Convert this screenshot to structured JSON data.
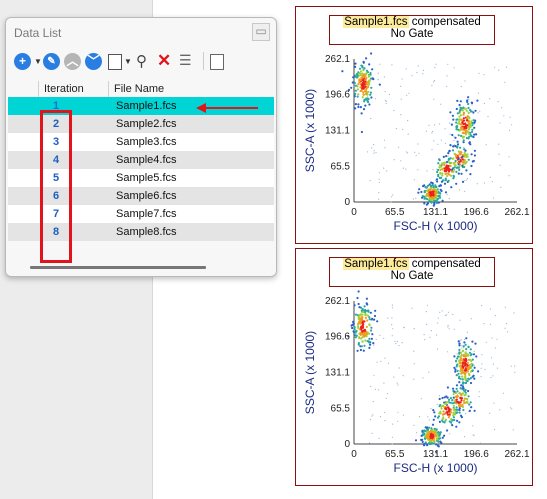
{
  "panel": {
    "title": "Data List",
    "close_glyph": "▭",
    "toolbar_icons": [
      "add-icon",
      "wrench-icon",
      "up-arrow-icon",
      "down-arrow-icon",
      "copy-icon",
      "search-icon",
      "delete-icon",
      "sort-icon",
      "report-icon"
    ],
    "columns": [
      "Iteration",
      "File Name"
    ],
    "rows": [
      {
        "iteration": "1",
        "file": "Sample1.fcs"
      },
      {
        "iteration": "2",
        "file": "Sample2.fcs"
      },
      {
        "iteration": "3",
        "file": "Sample3.fcs"
      },
      {
        "iteration": "4",
        "file": "Sample4.fcs"
      },
      {
        "iteration": "5",
        "file": "Sample5.fcs"
      },
      {
        "iteration": "6",
        "file": "Sample6.fcs"
      },
      {
        "iteration": "7",
        "file": "Sample7.fcs"
      },
      {
        "iteration": "8",
        "file": "Sample8.fcs"
      }
    ],
    "selected_row": 0
  },
  "colors": {
    "selected_row": "#00d4d4",
    "alt_row": "#e4e4e4",
    "annotation_red": "#e0141a",
    "plot_border": "#8a1010",
    "axis_label": "#1a2a80"
  },
  "plots": [
    {
      "title_file": "Sample1.fcs",
      "title_suffix": " compensated",
      "gate": "No Gate",
      "xlabel": "FSC-H (x 1000)",
      "ylabel": "SSC-A (x 1000)",
      "x_ticks": [
        "0",
        "65.5",
        "131.1",
        "196.6",
        "262.1"
      ],
      "y_ticks": [
        "0",
        "65.5",
        "131.1",
        "196.6",
        "262.1"
      ]
    },
    {
      "title_file": "Sample1.fcs",
      "title_suffix": " compensated",
      "gate": "No Gate",
      "xlabel": "FSC-H (x 1000)",
      "ylabel": "SSC-A (x 1000)",
      "x_ticks": [
        "0",
        "65.5",
        "131.1",
        "196.6",
        "262.1"
      ],
      "y_ticks": [
        "0",
        "65.5",
        "131.1",
        "196.6",
        "262.1"
      ]
    }
  ],
  "chart_data": [
    {
      "type": "scatter",
      "title": "Sample1.fcs compensated",
      "subtitle": "No Gate",
      "xlabel": "FSC-H (x 1000)",
      "ylabel": "SSC-A (x 1000)",
      "xlim": [
        0,
        262.1
      ],
      "ylim": [
        0,
        262.1
      ],
      "x_ticks": [
        0,
        65.5,
        131.1,
        196.6,
        262.1
      ],
      "y_ticks": [
        0,
        65.5,
        131.1,
        196.6,
        262.1
      ],
      "density_clusters": [
        {
          "x": 15,
          "y": 215,
          "density": "high"
        },
        {
          "x": 125,
          "y": 15,
          "density": "high"
        },
        {
          "x": 170,
          "y": 80,
          "density": "medium"
        },
        {
          "x": 178,
          "y": 145,
          "density": "high"
        },
        {
          "x": 150,
          "y": 60,
          "density": "medium"
        }
      ]
    },
    {
      "type": "scatter",
      "title": "Sample1.fcs compensated",
      "subtitle": "No Gate",
      "xlabel": "FSC-H (x 1000)",
      "ylabel": "SSC-A (x 1000)",
      "xlim": [
        0,
        262.1
      ],
      "ylim": [
        0,
        262.1
      ],
      "x_ticks": [
        0,
        65.5,
        131.1,
        196.6,
        262.1
      ],
      "y_ticks": [
        0,
        65.5,
        131.1,
        196.6,
        262.1
      ],
      "density_clusters": [
        {
          "x": 15,
          "y": 215,
          "density": "high"
        },
        {
          "x": 125,
          "y": 15,
          "density": "high"
        },
        {
          "x": 170,
          "y": 80,
          "density": "medium"
        },
        {
          "x": 178,
          "y": 145,
          "density": "high"
        },
        {
          "x": 150,
          "y": 60,
          "density": "medium"
        }
      ]
    }
  ]
}
